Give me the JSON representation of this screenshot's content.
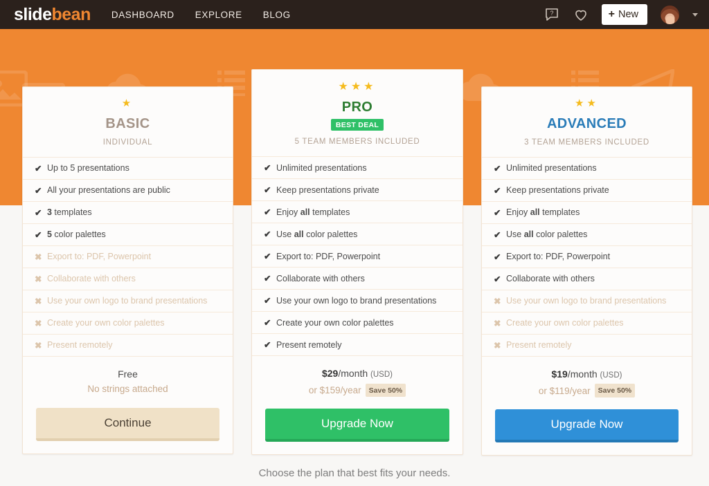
{
  "navbar": {
    "logo_slide": "slide",
    "logo_bean": "bean",
    "links": [
      {
        "label": "DASHBOARD",
        "name": "nav-link-dashboard"
      },
      {
        "label": "EXPLORE",
        "name": "nav-link-explore"
      },
      {
        "label": "BLOG",
        "name": "nav-link-blog"
      }
    ],
    "help_icon": "chat-question-icon",
    "favorites_icon": "heart-icon",
    "new_button": {
      "plus": "+",
      "label": "New"
    },
    "avatar_alt": "user-avatar",
    "caret_icon": "chevron-down-icon"
  },
  "background": {
    "color": "#ef8731",
    "watermark_icons": [
      "image-icon",
      "cloud-icon",
      "list-icon",
      "paper-plane-icon"
    ]
  },
  "plans": [
    {
      "id": "basic",
      "stars": "★",
      "star_count": 1,
      "name": "BASIC",
      "name_color": "#a49488",
      "badge": null,
      "subtitle": "INDIVIDUAL",
      "features": [
        {
          "enabled": true,
          "mark": "✔",
          "text": "Up to 5 presentations"
        },
        {
          "enabled": true,
          "mark": "✔",
          "text": "All your presentations are public"
        },
        {
          "enabled": true,
          "mark": "✔",
          "text_html": "<b>3</b> templates"
        },
        {
          "enabled": true,
          "mark": "✔",
          "text_html": "<b>5</b> color palettes"
        },
        {
          "enabled": false,
          "mark": "✖",
          "text": "Export to: PDF, Powerpoint"
        },
        {
          "enabled": false,
          "mark": "✖",
          "text": "Collaborate with others"
        },
        {
          "enabled": false,
          "mark": "✖",
          "text": "Use your own logo to brand presentations"
        },
        {
          "enabled": false,
          "mark": "✖",
          "text": "Create your own color palettes"
        },
        {
          "enabled": false,
          "mark": "✖",
          "text": "Present remotely"
        }
      ],
      "price_main_html": "Free",
      "price_sub_html": "No strings attached",
      "save_badge": null,
      "cta_label": "Continue",
      "cta_color": "#f0e1c7"
    },
    {
      "id": "pro",
      "stars": "★★★",
      "star_count": 3,
      "name": "PRO",
      "name_color": "#2e7d32",
      "badge": "BEST DEAL",
      "subtitle": "5 TEAM MEMBERS INCLUDED",
      "features": [
        {
          "enabled": true,
          "mark": "✔",
          "text": "Unlimited presentations"
        },
        {
          "enabled": true,
          "mark": "✔",
          "text": "Keep presentations private"
        },
        {
          "enabled": true,
          "mark": "✔",
          "text_html": "Enjoy <b>all</b> templates"
        },
        {
          "enabled": true,
          "mark": "✔",
          "text_html": "Use <b>all</b> color palettes"
        },
        {
          "enabled": true,
          "mark": "✔",
          "text": "Export to: PDF, Powerpoint"
        },
        {
          "enabled": true,
          "mark": "✔",
          "text": "Collaborate with others"
        },
        {
          "enabled": true,
          "mark": "✔",
          "text": "Use your own logo to brand presentations"
        },
        {
          "enabled": true,
          "mark": "✔",
          "text": "Create your own color palettes"
        },
        {
          "enabled": true,
          "mark": "✔",
          "text": "Present remotely"
        }
      ],
      "price_main_html": "<b>$29</b>/month <span class=\"usd\">(USD)</span>",
      "price_sub_html": "or $159/year",
      "save_badge": "Save 50%",
      "cta_label": "Upgrade Now",
      "cta_color": "#2fc067"
    },
    {
      "id": "advanced",
      "stars": "★★",
      "star_count": 2,
      "name": "ADVANCED",
      "name_color": "#2a7cb8",
      "badge": null,
      "subtitle": "3 TEAM MEMBERS INCLUDED",
      "features": [
        {
          "enabled": true,
          "mark": "✔",
          "text": "Unlimited presentations"
        },
        {
          "enabled": true,
          "mark": "✔",
          "text": "Keep presentations private"
        },
        {
          "enabled": true,
          "mark": "✔",
          "text_html": "Enjoy <b>all</b> templates"
        },
        {
          "enabled": true,
          "mark": "✔",
          "text_html": "Use <b>all</b> color palettes"
        },
        {
          "enabled": true,
          "mark": "✔",
          "text": "Export to: PDF, Powerpoint"
        },
        {
          "enabled": true,
          "mark": "✔",
          "text": "Collaborate with others"
        },
        {
          "enabled": false,
          "mark": "✖",
          "text": "Use your own logo to brand presentations"
        },
        {
          "enabled": false,
          "mark": "✖",
          "text": "Create your own color palettes"
        },
        {
          "enabled": false,
          "mark": "✖",
          "text": "Present remotely"
        }
      ],
      "price_main_html": "<b>$19</b>/month <span class=\"usd\">(USD)</span>",
      "price_sub_html": "or $119/year",
      "save_badge": "Save 50%",
      "cta_label": "Upgrade Now",
      "cta_color": "#2f90d8"
    }
  ],
  "footnote": "Choose the plan that best fits your needs."
}
